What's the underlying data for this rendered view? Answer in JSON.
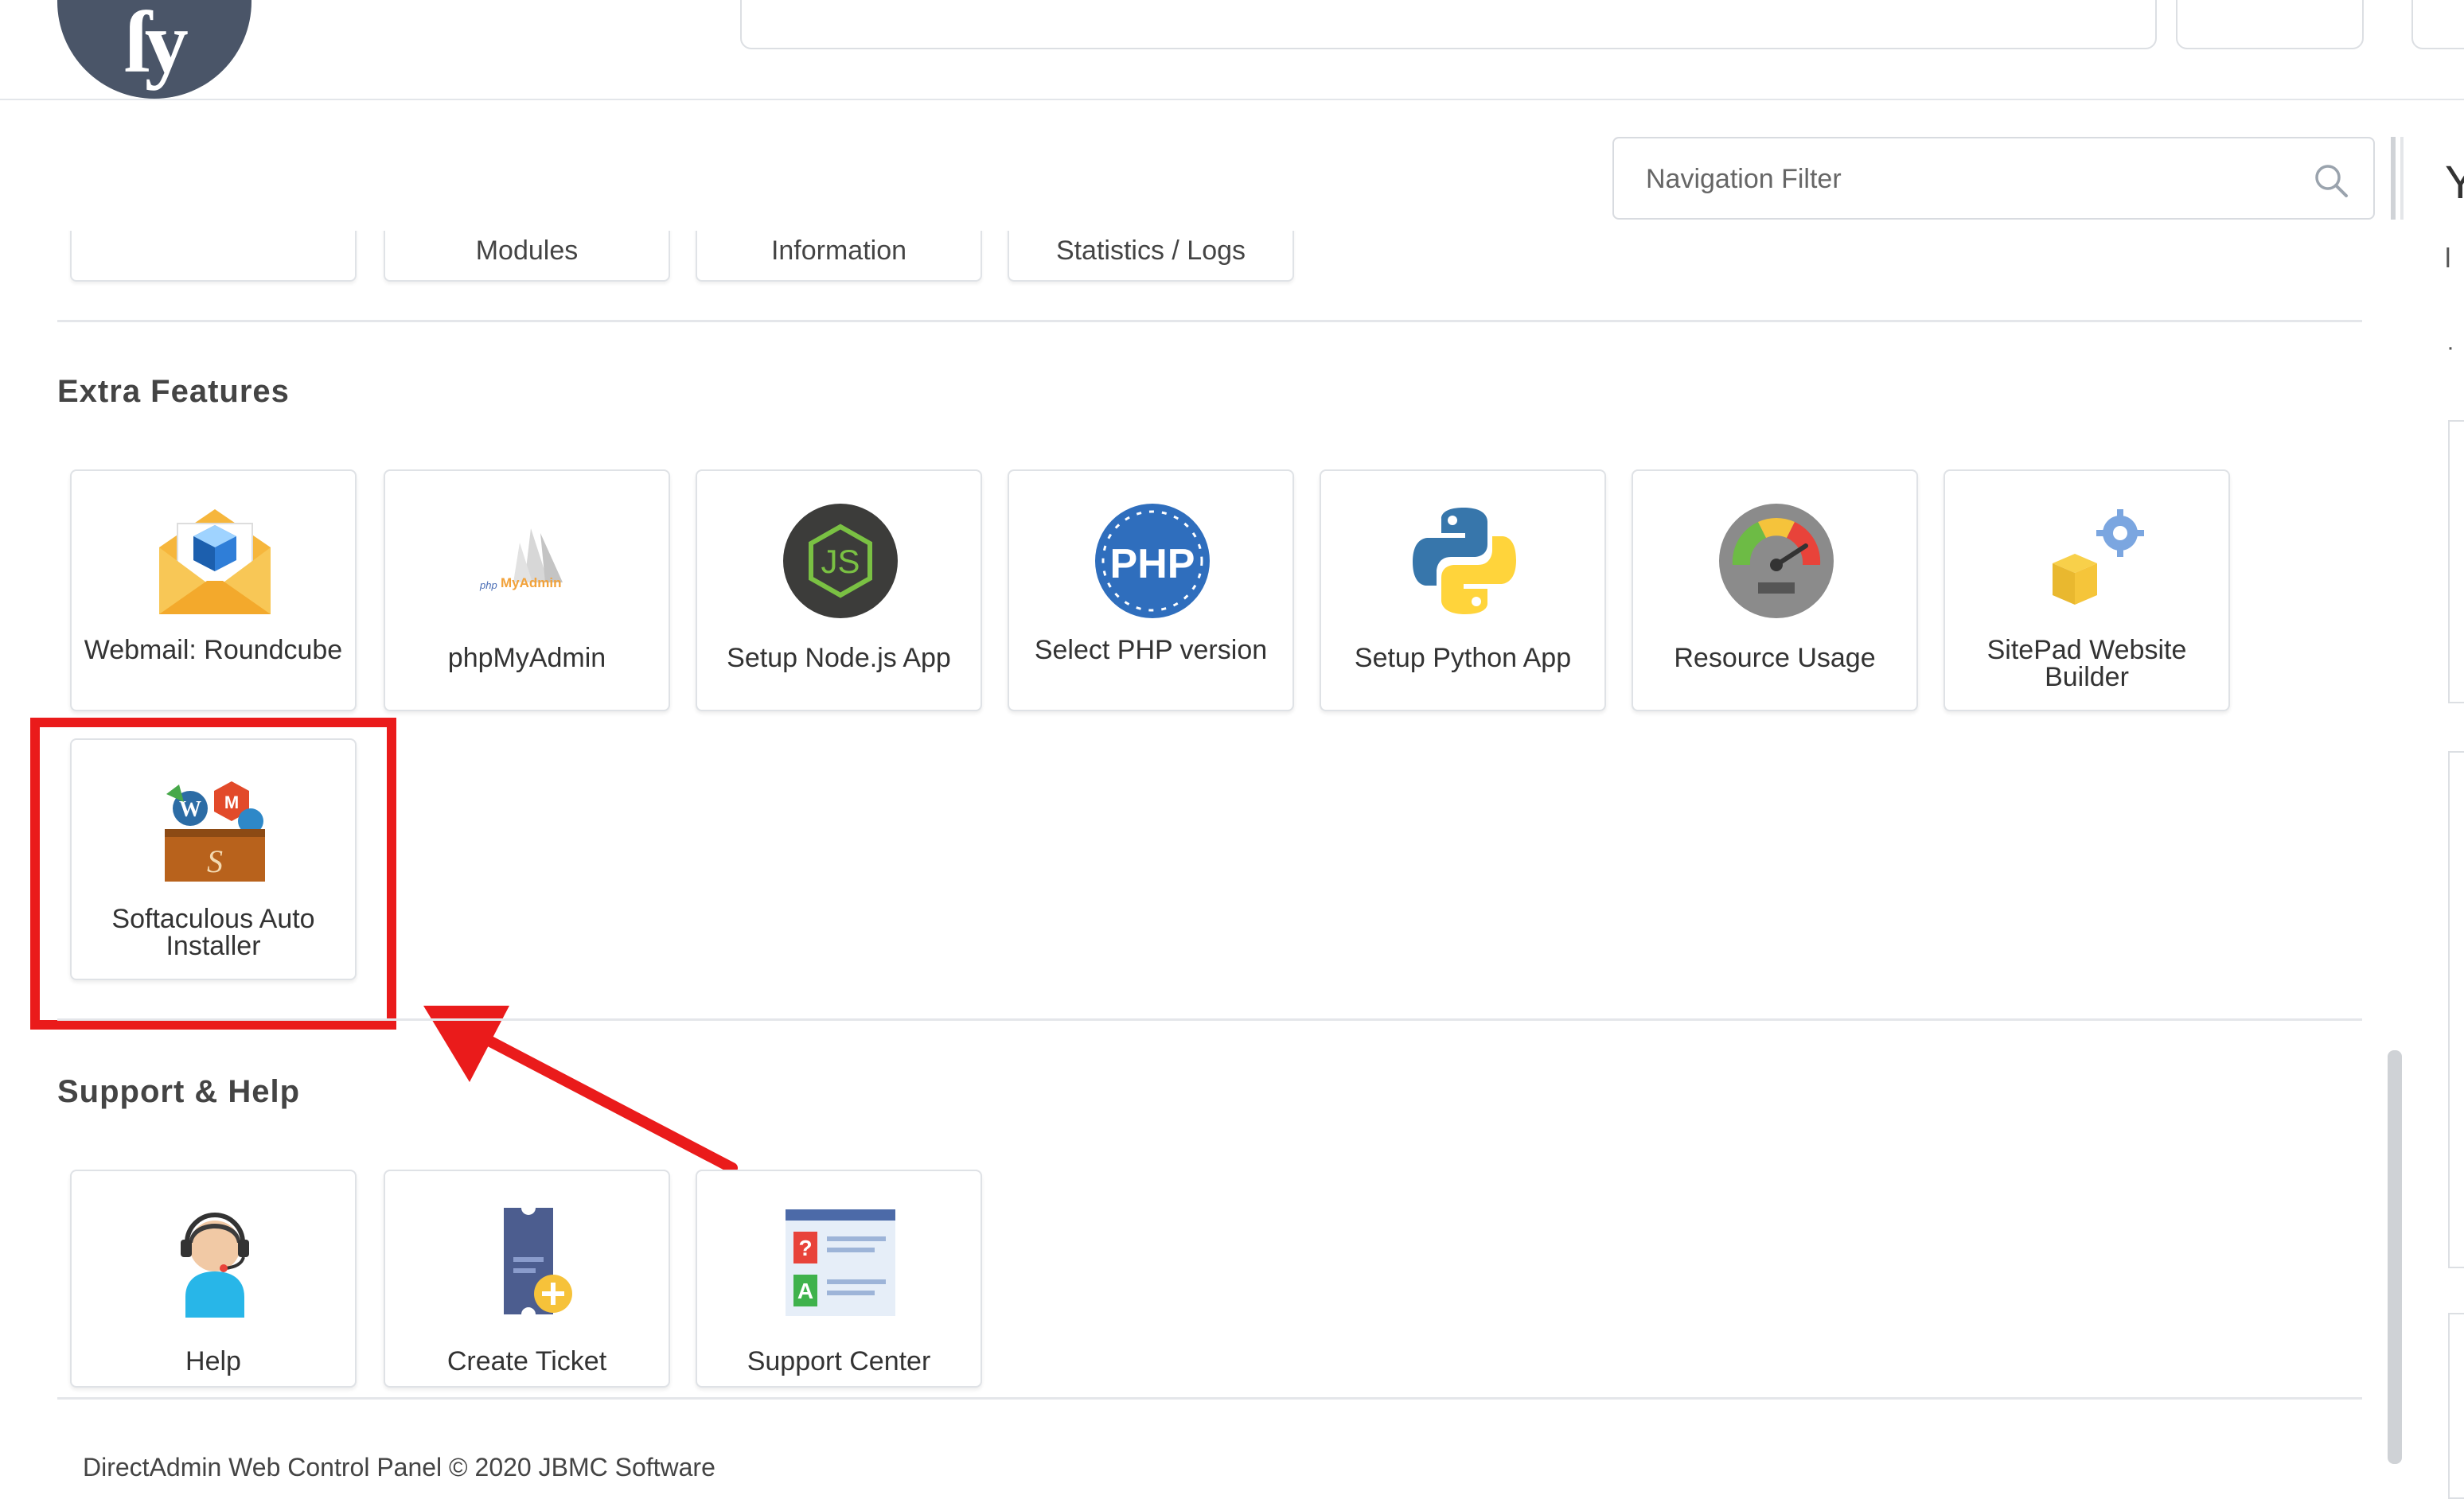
{
  "search": {
    "placeholder": "Navigation Filter"
  },
  "top_partial_tiles": [
    {
      "label": ""
    },
    {
      "label": "Modules"
    },
    {
      "label": "Information"
    },
    {
      "label": "Statistics / Logs"
    }
  ],
  "extra_features": {
    "title": "Extra Features",
    "items": [
      {
        "label": "Webmail: Roundcube",
        "icon": "webmail-envelope-icon"
      },
      {
        "label": "phpMyAdmin",
        "icon": "phpmyadmin-icon"
      },
      {
        "label": "Setup Node.js App",
        "icon": "nodejs-icon"
      },
      {
        "label": "Select PHP version",
        "icon": "php-icon"
      },
      {
        "label": "Setup Python App",
        "icon": "python-icon"
      },
      {
        "label": "Resource Usage",
        "icon": "gauge-icon"
      },
      {
        "label": "SitePad Website Builder",
        "icon": "sitepad-box-gear-icon"
      },
      {
        "label": "Softaculous Auto Installer",
        "icon": "softaculous-box-icon"
      }
    ]
  },
  "support_help": {
    "title": "Support & Help",
    "items": [
      {
        "label": "Help",
        "icon": "headset-agent-icon"
      },
      {
        "label": "Create Ticket",
        "icon": "ticket-icon"
      },
      {
        "label": "Support Center",
        "icon": "qa-board-icon"
      }
    ]
  },
  "footer": {
    "text": "DirectAdmin Web Control Panel © 2020 JBMC Software"
  },
  "colors": {
    "highlight": "#ea1b1b",
    "logo": "#4a5568",
    "php": "#2f6ebd",
    "nodejs": "#3c3c3a",
    "python_blue": "#3776ab",
    "python_yellow": "#ffd43b"
  }
}
